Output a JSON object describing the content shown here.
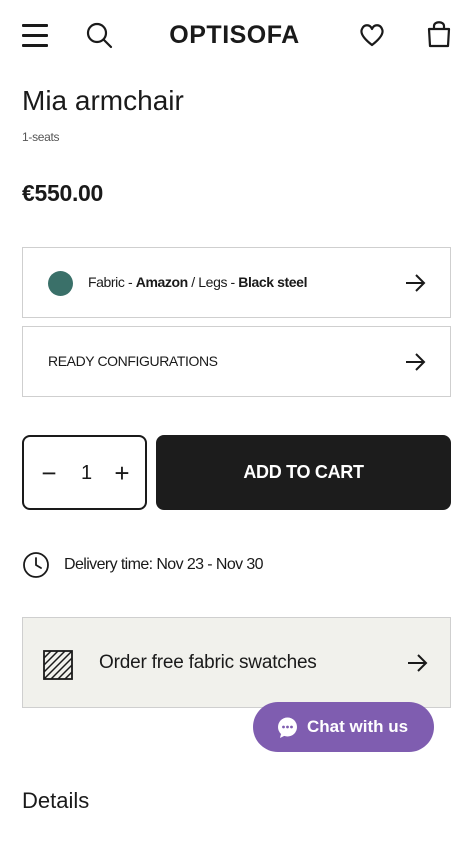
{
  "header": {
    "logo": "OPTISOFA",
    "icons": [
      "menu-icon",
      "search-icon",
      "heart-icon",
      "shopping-bag-icon"
    ]
  },
  "product": {
    "title": "Mia armchair",
    "subtitle": "1-seats",
    "price": "€550.00"
  },
  "configuration": {
    "fabric_label": "Fabric - ",
    "fabric_value": "Amazon",
    "separator": " / ",
    "legs_label": "Legs - ",
    "legs_value": "Black steel",
    "swatch_color": "#3a7069",
    "ready_configurations": "READY CONFIGURATIONS"
  },
  "cart": {
    "quantity": "1",
    "minus": "−",
    "plus": "+",
    "add_to_cart": "ADD TO CART"
  },
  "delivery": {
    "text": "Delivery time: Nov 23 - Nov 30"
  },
  "swatches": {
    "text": "Order free fabric swatches"
  },
  "chat": {
    "label": "Chat with us",
    "color": "#7f5db0"
  },
  "sections": {
    "details": "Details"
  }
}
